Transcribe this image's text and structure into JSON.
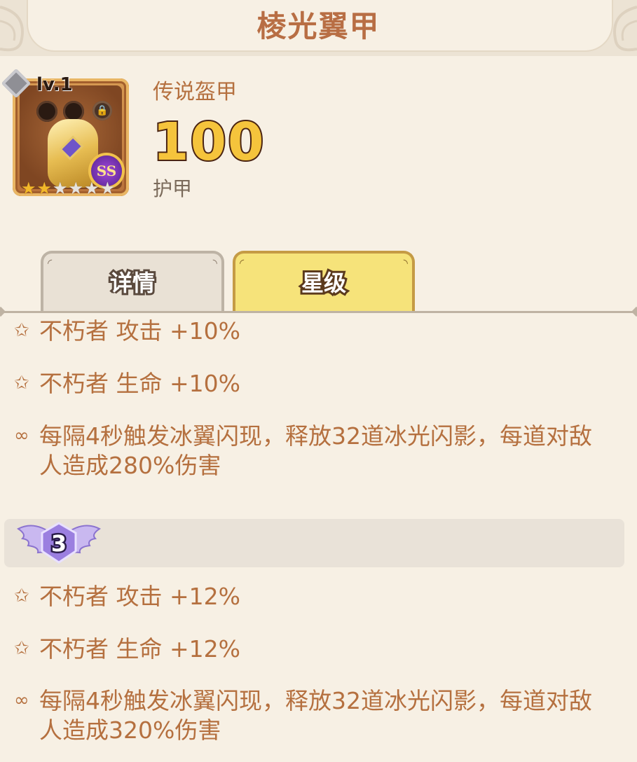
{
  "header": {
    "title": "棱光翼甲"
  },
  "item": {
    "level": "lv.1",
    "type": "传说盔甲",
    "value": "100",
    "stat_label": "护甲",
    "grade_badge": "SS",
    "stars": {
      "filled": 2,
      "total": 6
    }
  },
  "tabs": [
    {
      "label": "详情",
      "active": false
    },
    {
      "label": "星级",
      "active": true
    }
  ],
  "section1": {
    "rows": [
      {
        "icon": "star-outline-icon",
        "text": "不朽者 攻击 +10%"
      },
      {
        "icon": "star-outline-icon",
        "text": "不朽者 生命 +10%"
      },
      {
        "icon": "link-icon",
        "text": "每隔4秒触发冰翼闪现，释放32道冰光闪影，每道对敌人造成280%伤害"
      }
    ]
  },
  "tier": {
    "number": "3"
  },
  "section2": {
    "rows": [
      {
        "icon": "star-outline-icon",
        "text": "不朽者 攻击 +12%"
      },
      {
        "icon": "star-outline-icon",
        "text": "不朽者 生命 +12%"
      },
      {
        "icon": "link-icon",
        "text": "每隔4秒触发冰翼闪现，释放32道冰光闪影，每道对敌人造成320%伤害"
      }
    ]
  },
  "colors": {
    "accent_text": "#b5703f",
    "active_tab": "#f6e37a",
    "star_on": "#f3b829"
  }
}
